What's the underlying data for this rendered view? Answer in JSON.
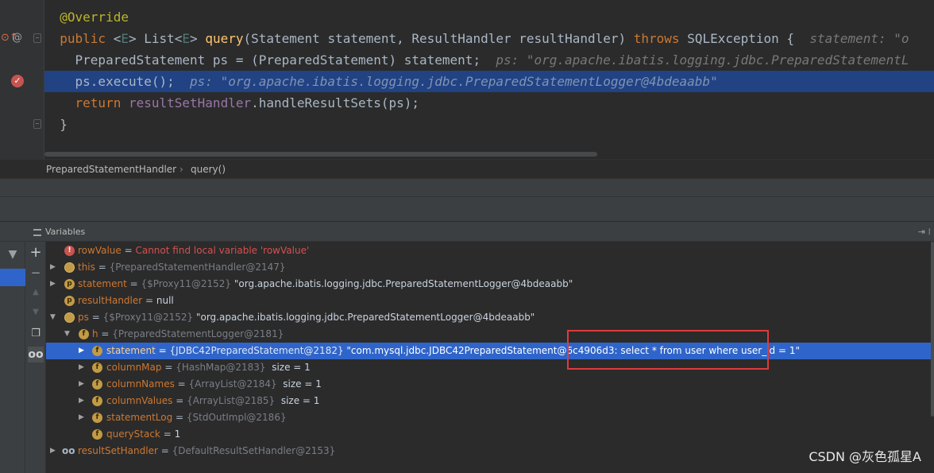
{
  "editor": {
    "lines": [
      {
        "t1": "@Override"
      },
      {
        "kw1": "public",
        "p1": " <",
        "tp1": "E",
        "p2": "> List<",
        "tp2": "E",
        "p3": "> ",
        "mt": "query",
        "p4": "(Statement statement, ResultHandler resultHandler) ",
        "kw2": "throws",
        "p5": " SQLException {  ",
        "hint": "statement: \"o"
      },
      {
        "code": "PreparedStatement ps = (PreparedStatement) statement;",
        "hint": "ps: \"org.apache.ibatis.logging.jdbc.PreparedStatementL"
      },
      {
        "code": "ps.execute();",
        "hint": "ps: \"org.apache.ibatis.logging.jdbc.PreparedStatementLogger@4bdeaabb\""
      },
      {
        "kw": "return",
        "fld": "resultSetHandler",
        "code": ".handleResultSets(ps);"
      },
      {
        "code": "}"
      }
    ]
  },
  "breadcrumb": {
    "class_name": "PreparedStatementHandler",
    "sep": "›",
    "method": "query()"
  },
  "panel": {
    "title": "Variables",
    "corner": "⇥ ⁞"
  },
  "variables": [
    {
      "name": "rowValue",
      "eq": " = ",
      "value": "Cannot find local variable 'rowValue'"
    },
    {
      "name": "this",
      "eq": " = ",
      "desc": "{PreparedStatementHandler@2147}"
    },
    {
      "name": "statement",
      "eq": " = ",
      "desc": "{$Proxy11@2152}",
      "value": " \"org.apache.ibatis.logging.jdbc.PreparedStatementLogger@4bdeaabb\""
    },
    {
      "name": "resultHandler",
      "eq": " = ",
      "value": "null"
    },
    {
      "name": "ps",
      "eq": " = ",
      "desc": "{$Proxy11@2152}",
      "value": " \"org.apache.ibatis.logging.jdbc.PreparedStatementLogger@4bdeaabb\""
    },
    {
      "name": "h",
      "eq": " = ",
      "desc": "{PreparedStatementLogger@2181}"
    },
    {
      "name": "statement",
      "eq": " = ",
      "desc": "{JDBC42PreparedStatement@2182}",
      "value": " \"com.mysql.jdbc.JDBC42PreparedStatement@6c4906d3: select * from user where user_id = 1\""
    },
    {
      "name": "columnMap",
      "eq": " = ",
      "desc": "{HashMap@2183}",
      "value": "  size = 1"
    },
    {
      "name": "columnNames",
      "eq": " = ",
      "desc": "{ArrayList@2184}",
      "value": "  size = 1"
    },
    {
      "name": "columnValues",
      "eq": " = ",
      "desc": "{ArrayList@2185}",
      "value": "  size = 1"
    },
    {
      "name": "statementLog",
      "eq": " = ",
      "desc": "{StdOutImpl@2186}"
    },
    {
      "name": "queryStack",
      "eq": " = ",
      "value": "1"
    },
    {
      "name": "resultSetHandler",
      "eq": " = ",
      "desc": "{DefaultResultSetHandler@2153}"
    }
  ],
  "watermark": "CSDN @灰色孤星A",
  "colors": {
    "highlight": "#214283",
    "selection": "#2f65ca",
    "annotation_box": "#e03a3a"
  },
  "icons": [
    "breakpoint-icon",
    "override-icon",
    "filter-icon",
    "add-watch-icon",
    "copy-icon",
    "watches-icon",
    "expand-arrow-icon",
    "parameter-icon",
    "field-icon",
    "error-icon"
  ]
}
